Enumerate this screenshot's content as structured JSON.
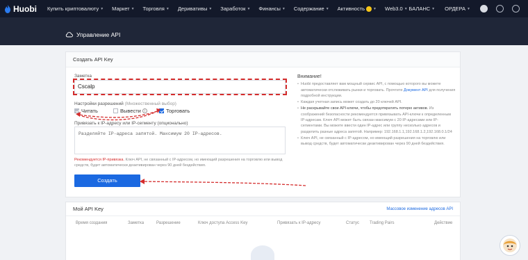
{
  "nav": {
    "logo": "Huobi",
    "items": [
      {
        "label": "Купить криптовалюту"
      },
      {
        "label": "Маркет"
      },
      {
        "label": "Торговля"
      },
      {
        "label": "Деривативы"
      },
      {
        "label": "Заработок"
      },
      {
        "label": "Финансы"
      },
      {
        "label": "Содержание"
      },
      {
        "label": "Активность"
      },
      {
        "label": "Web3.0"
      }
    ],
    "right": {
      "balance": "БАЛАНС",
      "orders": "ОРДЕРА"
    }
  },
  "page": {
    "title": "Управление API"
  },
  "create": {
    "header": "Создать API Key",
    "note_label": "Заметка",
    "note_value": "Cscalp",
    "perm_label": "Настройки разрешений",
    "perm_hint": "(Множественный выбор)",
    "perm_read": "Читать",
    "perm_withdraw": "Вывести",
    "perm_trade": "Торговать",
    "ip_label": "Привязать к IP-адресу или IP-сегменту (опционально)",
    "ip_placeholder": "Разделяйте IP-адреса запятой. Максимум 20 IP-адресов.",
    "warn_red": "Рекомендуется IP-привязка.",
    "warn_rest": " Ключ API, не связанный с IP-адресом, но имеющий разрешения на торговлю или вывод средств, будет автоматически деактивирован через 90 дней бездействия.",
    "button": "Создать"
  },
  "notice": {
    "title": "Внимание!",
    "items": [
      {
        "pre": "Huobi предоставляет вам мощный сервис API, с помощью которого вы можете автоматически отслеживать рынки и торговать. Прочтите ",
        "link": "Документ API",
        "post": " для получения подробной инструкции."
      },
      {
        "pre": "Каждая учетная запись может создать до 20 ключей API.",
        "link": "",
        "post": ""
      },
      {
        "pre": "Не раскрывайте свои API-ключи, чтобы предотвратить потерю активов.",
        "link": "",
        "post": " Из соображений безопасности рекомендуется привязывать API-ключи к определенным IP-адресам. Ключ API может быть связан максимум с 20 IP-адресами или IP-сегментами. Вы можете ввести один IP-адрес или группу несколько адресов и разделить разные адреса запятой. Например: 192.168.1.1,192.168.1.2,192.168.0.1/24"
      },
      {
        "pre": "Ключ API, не связанный с IP-адресом, но имеющий разрешения на торговлю или вывод средств, будет автоматически деактивирован через 90 дней бездействия.",
        "link": "",
        "post": ""
      }
    ]
  },
  "myapi": {
    "header": "Мой API Key",
    "bulk_link": "Массовое изменение адресов API",
    "columns": [
      "Время создания",
      "Заметка",
      "Разрешение",
      "Ключ доступа Access Key",
      "Привязать к IP-адресу",
      "Статус",
      "Trading Pairs",
      "Действие"
    ]
  },
  "colors": {
    "accent": "#1b69e1",
    "nav_bg": "#13192a",
    "band_bg": "#1f2638",
    "annotation": "#d42c2c"
  }
}
